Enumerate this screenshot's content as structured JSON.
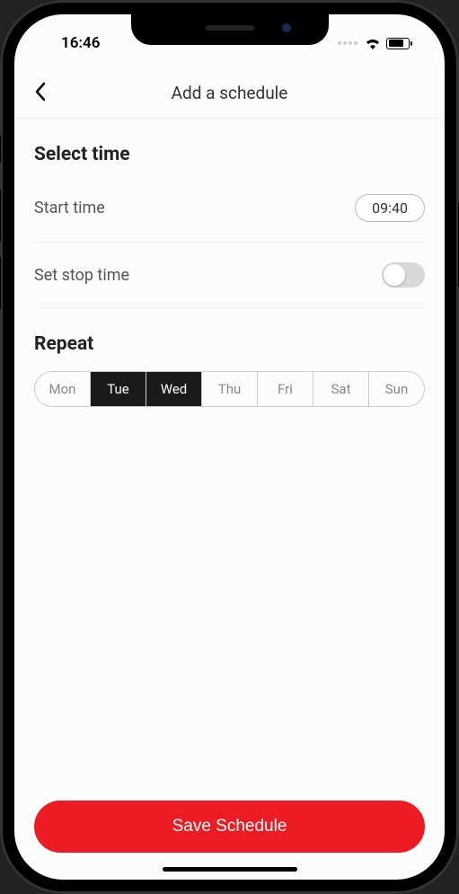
{
  "status": {
    "time": "16:46"
  },
  "header": {
    "title": "Add a schedule"
  },
  "select_time": {
    "section_label": "Select time",
    "start_label": "Start time",
    "start_value": "09:40",
    "stop_label": "Set stop time",
    "stop_enabled": false
  },
  "repeat": {
    "section_label": "Repeat",
    "days": [
      {
        "label": "Mon",
        "selected": false
      },
      {
        "label": "Tue",
        "selected": true
      },
      {
        "label": "Wed",
        "selected": true
      },
      {
        "label": "Thu",
        "selected": false
      },
      {
        "label": "Fri",
        "selected": false
      },
      {
        "label": "Sat",
        "selected": false
      },
      {
        "label": "Sun",
        "selected": false
      }
    ]
  },
  "footer": {
    "save_label": "Save Schedule"
  }
}
